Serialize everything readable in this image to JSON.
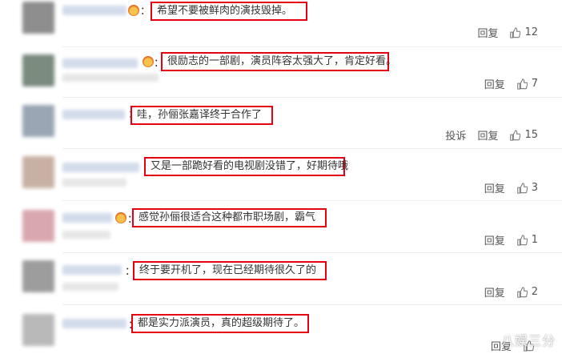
{
  "comments": [
    {
      "text": "希望不要被鲜肉的演技毁掉。",
      "reply": "回复",
      "likes": "12",
      "report": ""
    },
    {
      "text": "很励志的一部剧，演员阵容太强大了，肯定好看。",
      "reply": "回复",
      "likes": "7",
      "report": ""
    },
    {
      "text": "哇，孙俪张嘉译终于合作了",
      "reply": "回复",
      "likes": "15",
      "report": "投诉"
    },
    {
      "text": "又是一部跪好看的电视剧没错了，好期待哦",
      "reply": "回复",
      "likes": "3",
      "report": ""
    },
    {
      "text": "感觉孙俪很适合这种都市职场剧，霸气",
      "reply": "回复",
      "likes": "1",
      "report": ""
    },
    {
      "text": "终于要开机了，现在已经期待很久了的",
      "reply": "回复",
      "likes": "2",
      "report": ""
    },
    {
      "text": "都是实力派演员，真的超级期待了。",
      "reply": "回复",
      "likes": "",
      "report": ""
    }
  ],
  "watermark": "八娱三分",
  "colors": {
    "highlight_border": "#e60012",
    "text": "#333333",
    "action": "#555555"
  },
  "icons": {
    "like": "thumbs-up-icon",
    "badge": "fan-badge-icon"
  }
}
